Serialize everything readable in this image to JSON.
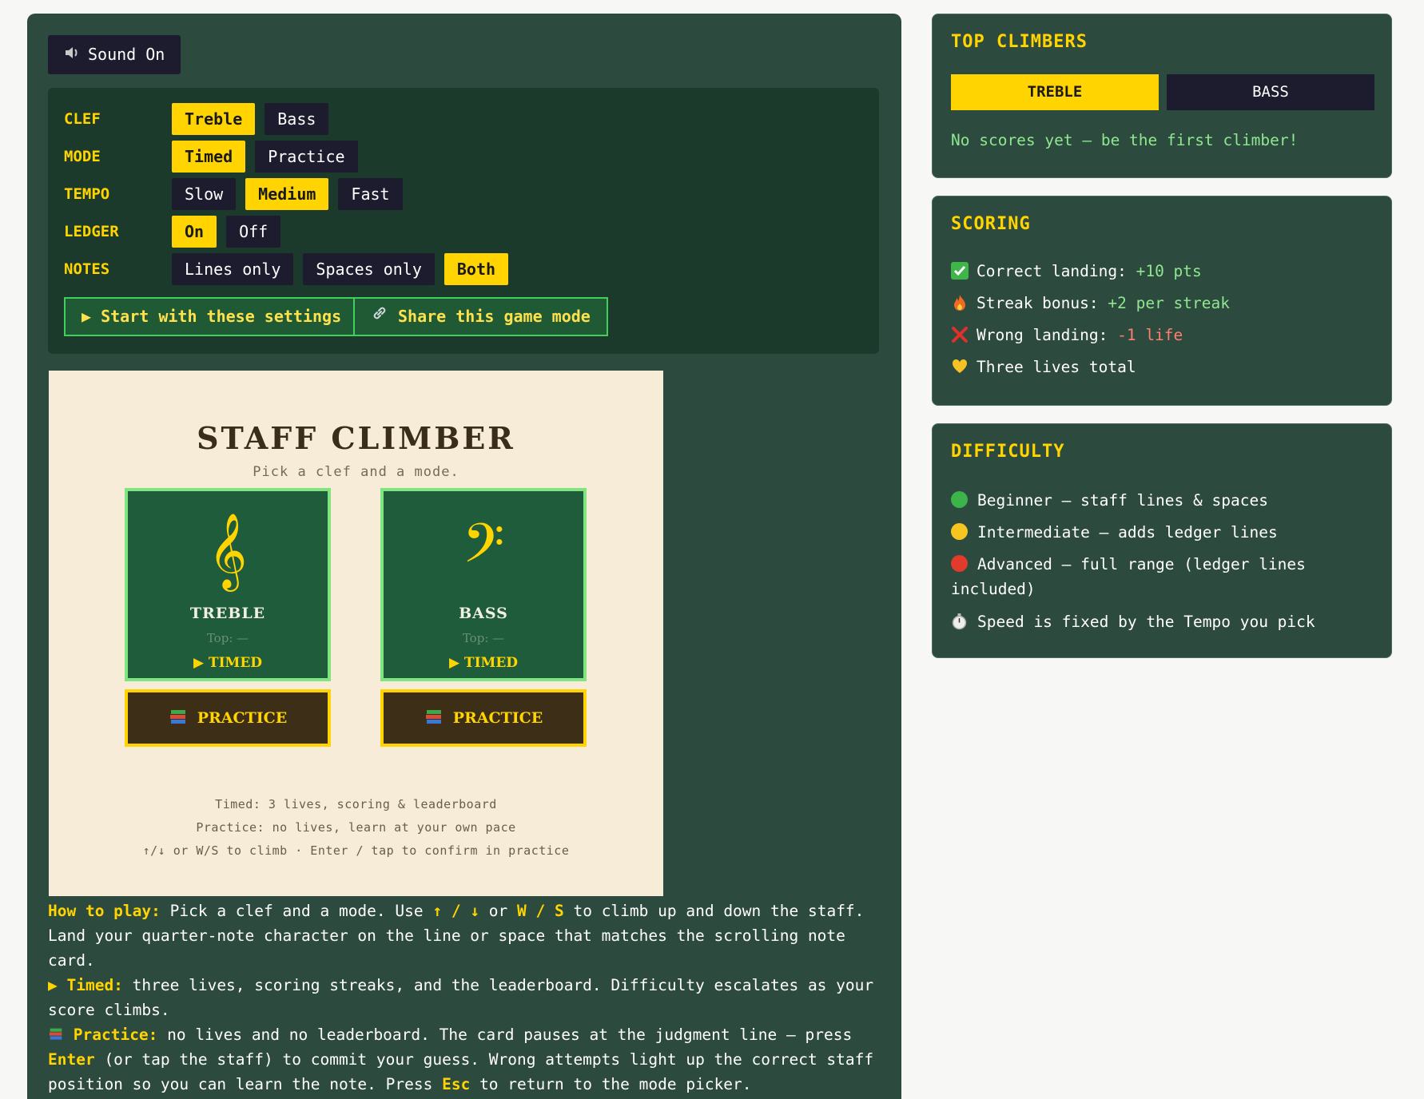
{
  "sound": {
    "icon": "speaker-icon",
    "label": "Sound On"
  },
  "settings": {
    "rows": [
      {
        "label": "CLEF",
        "options": [
          "Treble",
          "Bass"
        ],
        "selected": 0
      },
      {
        "label": "MODE",
        "options": [
          "Timed",
          "Practice"
        ],
        "selected": 0
      },
      {
        "label": "TEMPO",
        "options": [
          "Slow",
          "Medium",
          "Fast"
        ],
        "selected": 1
      },
      {
        "label": "LEDGER",
        "options": [
          "On",
          "Off"
        ],
        "selected": 0
      },
      {
        "label": "NOTES",
        "options": [
          "Lines only",
          "Spaces only",
          "Both"
        ],
        "selected": 2
      }
    ],
    "start_label": "▶ Start with these settings",
    "share_label": "Share this game mode"
  },
  "game": {
    "title": "STAFF CLIMBER",
    "subtitle": "Pick a clef and a mode.",
    "cards": [
      {
        "symbol": "𝄞",
        "name": "TREBLE",
        "top": "Top: —",
        "timed": "▶ TIMED",
        "practice": "PRACTICE"
      },
      {
        "symbol": "𝄢",
        "name": "BASS",
        "top": "Top: —",
        "timed": "▶ TIMED",
        "practice": "PRACTICE"
      }
    ],
    "notes": [
      "Timed: 3 lives, scoring & leaderboard",
      "Practice: no lives, learn at your own pace",
      "↑/↓ or W/S to climb · Enter / tap to confirm in practice"
    ]
  },
  "howto": {
    "p1_label": "How to play:",
    "p1_a": " Pick a clef and a mode. Use ",
    "p1_keys1": "↑ / ↓",
    "p1_b": " or ",
    "p1_keys2": "W / S",
    "p1_c": " to climb up and down the staff. Land your quarter-note character on the line or space that matches the scrolling note card.",
    "p2_label": "▶ Timed:",
    "p2_text": " three lives, scoring streaks, and the leaderboard. Difficulty escalates as your score climbs.",
    "p3_label": "Practice:",
    "p3_a": " no lives and no leaderboard. The card pauses at the judgment line — press ",
    "p3_enter": "Enter",
    "p3_b": " (or tap the staff) to commit your guess. Wrong attempts light up the correct staff position so you can learn the note. Press ",
    "p3_esc": "Esc",
    "p3_c": " to return to the mode picker."
  },
  "leaderboard": {
    "title": "TOP CLIMBERS",
    "tabs": [
      "TREBLE",
      "BASS"
    ],
    "empty": "No scores yet — be the first climber!"
  },
  "scoring": {
    "title": "SCORING",
    "items": [
      {
        "label": "Correct landing: ",
        "value": "+10 pts"
      },
      {
        "label": "Streak bonus: ",
        "value": "+2 per streak"
      },
      {
        "label": "Wrong landing: ",
        "value": "-1 life"
      },
      {
        "label": "Three lives total",
        "value": ""
      }
    ]
  },
  "difficulty": {
    "title": "DIFFICULTY",
    "items": [
      "Beginner — staff lines & spaces",
      "Intermediate — adds ledger lines",
      "Advanced — full range (ledger lines included)",
      "Speed is fixed by the Tempo you pick"
    ]
  },
  "colors": {
    "accent": "#ffd400",
    "panel": "#2d4a3e",
    "positive": "#8fe88f",
    "negative": "#ff7f6e"
  }
}
